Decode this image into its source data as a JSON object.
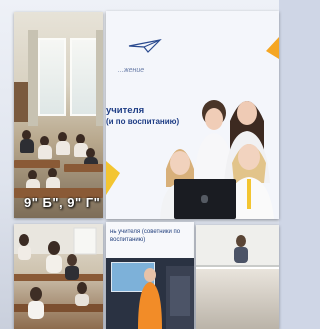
{
  "collage": {
    "top_left": {
      "caption": "9\" Б\", 9\" Г\""
    },
    "top_right": {
      "slide_subtitle": "...жение",
      "slide_title": "учителя",
      "slide_title_line2": "(и по воспитанию)"
    },
    "bottom_middle": {
      "banner_text": "нь учителя (советники по воспитанию)"
    }
  },
  "colors": {
    "slide_blue": "#1f3e86",
    "accent_orange": "#f5a623",
    "accent_yellow": "#f3c531"
  }
}
